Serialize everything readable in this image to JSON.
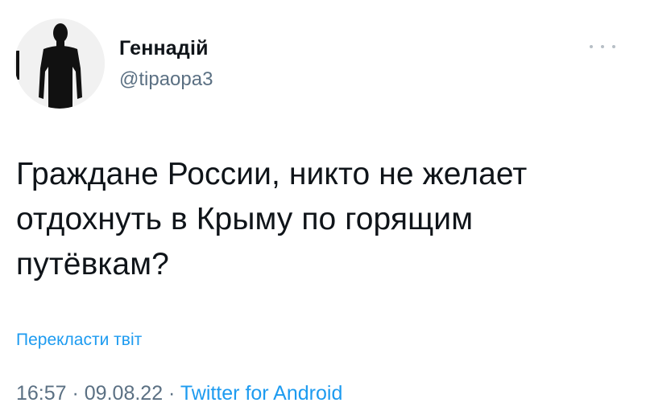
{
  "author": {
    "name": "Геннадій",
    "handle": "@tipaopa3",
    "avatar_icon": "silhouette-avatar"
  },
  "more_icon": "more-dots-icon",
  "tweet": {
    "text": "Граждане России, никто не желает\nотдохнуть в Крыму по горящим\nпутёвкам?"
  },
  "translate_label": "Перекласти твіт",
  "meta": {
    "time": "16:57",
    "separator1": " · ",
    "date": "09.08.22",
    "separator2": " · ",
    "source": "Twitter for Android"
  },
  "colors": {
    "link": "#1d9bf0",
    "secondary": "#5b7083",
    "text": "#0f1419"
  }
}
